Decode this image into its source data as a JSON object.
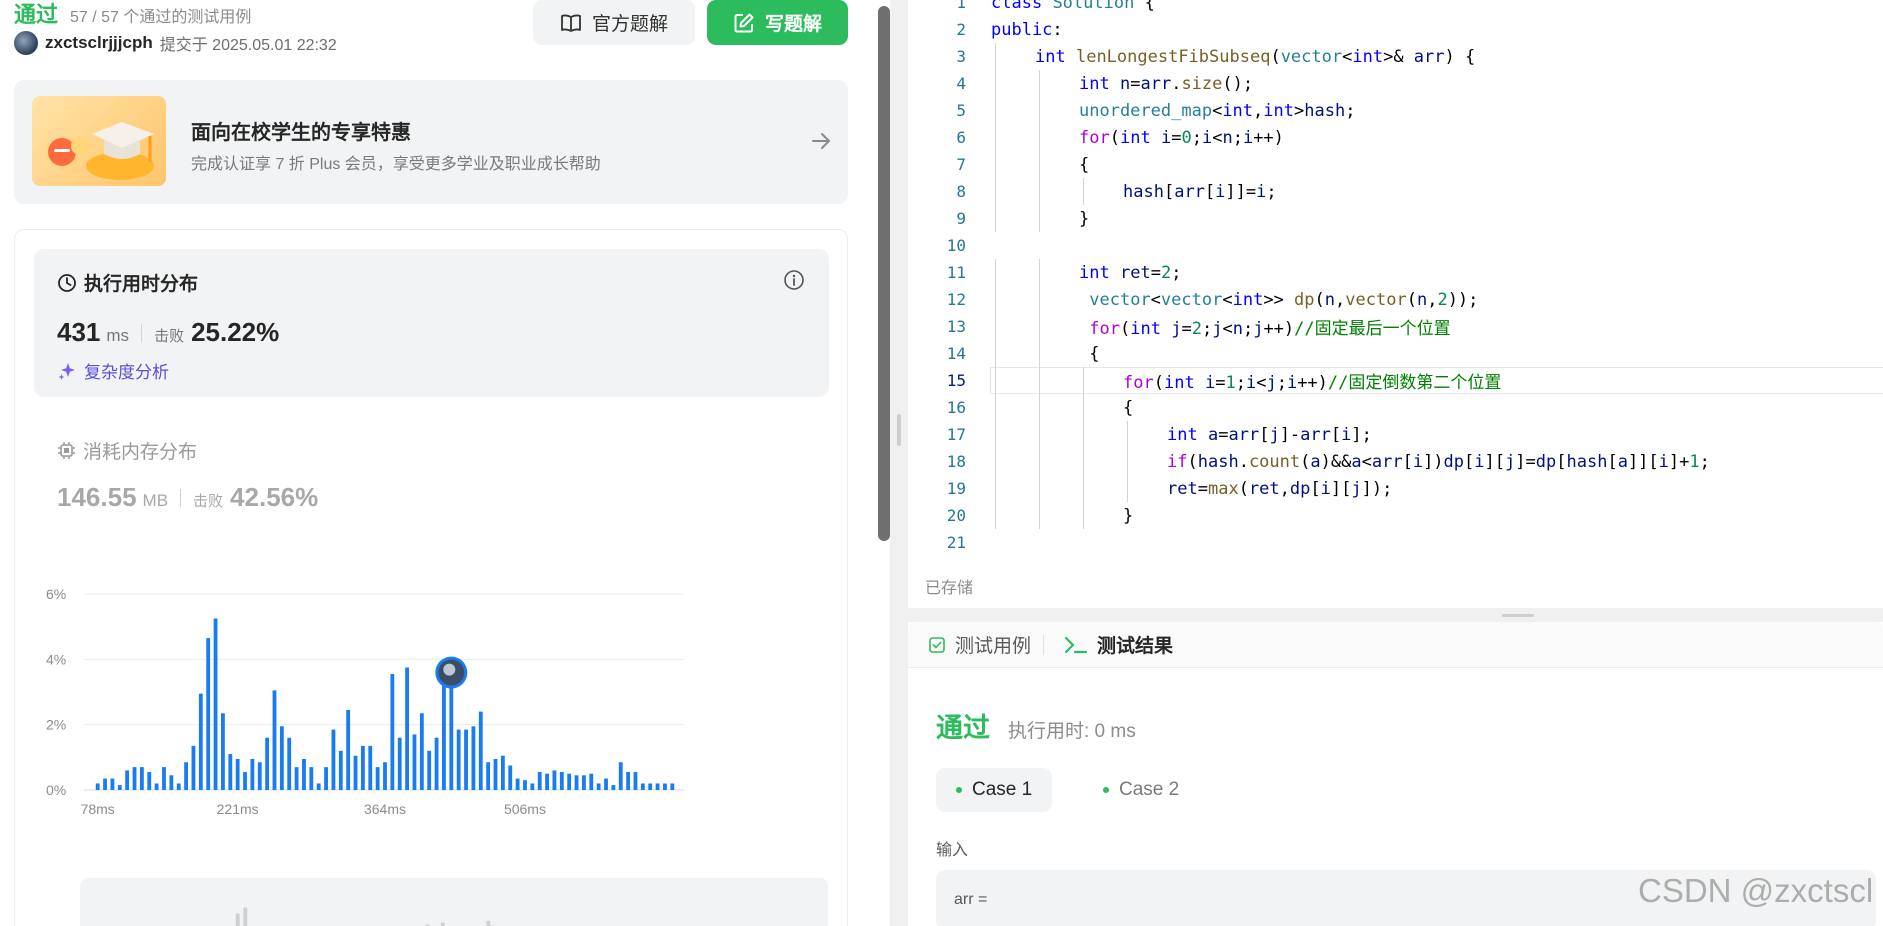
{
  "submission": {
    "status": "通过",
    "cases_passed": "57 / 57 个通过的测试用例",
    "author": "zxctsclrjjjcph",
    "submitted_at": "提交于 2025.05.01 22:32"
  },
  "buttons": {
    "official_solution": "官方题解",
    "write_solution": "写题解"
  },
  "promo": {
    "title": "面向在校学生的专享特惠",
    "subtitle": "完成认证享 7 折 Plus 会员，享受更多学业及职业成长帮助"
  },
  "runtime": {
    "title": "执行用时分布",
    "value": "431",
    "unit": "ms",
    "beat_label": "击败",
    "beat_pct": "25.22%",
    "complexity_link": "复杂度分析"
  },
  "memory": {
    "title": "消耗内存分布",
    "value": "146.55",
    "unit": "MB",
    "beat_label": "击败",
    "beat_pct": "42.56%"
  },
  "chart_data": {
    "type": "bar",
    "ylim": [
      0,
      6
    ],
    "yticks": [
      "0%",
      "2%",
      "4%",
      "6%"
    ],
    "xtick_labels": [
      "78ms",
      "221ms",
      "364ms",
      "506ms"
    ],
    "xtick_bar_index": [
      0,
      19,
      39,
      58
    ],
    "user_bar_index": 48,
    "color": "#1a7cf2",
    "values": [
      0.2,
      0.35,
      0.35,
      0.15,
      0.6,
      0.7,
      0.7,
      0.55,
      0.2,
      0.7,
      0.45,
      0.2,
      0.85,
      1.35,
      2.95,
      4.65,
      5.25,
      2.35,
      1.1,
      0.95,
      0.55,
      0.95,
      0.85,
      1.6,
      3.05,
      1.95,
      1.6,
      0.7,
      0.95,
      0.7,
      0.2,
      0.7,
      1.85,
      1.2,
      2.45,
      1.05,
      1.35,
      1.35,
      0.7,
      0.85,
      3.55,
      1.6,
      3.75,
      1.7,
      2.35,
      1.2,
      1.6,
      3.3,
      3.9,
      1.85,
      1.85,
      1.95,
      2.4,
      0.85,
      0.95,
      1.05,
      0.75,
      0.35,
      0.3,
      0.2,
      0.55,
      0.5,
      0.6,
      0.55,
      0.5,
      0.45,
      0.45,
      0.5,
      0.2,
      0.35,
      0.15,
      0.85,
      0.55,
      0.55,
      0.2,
      0.2,
      0.2,
      0.2,
      0.2
    ]
  },
  "mini_chart": {
    "labels": [
      "78",
      "221",
      "364",
      "506"
    ]
  },
  "editor": {
    "lines": [
      {
        "n": "1",
        "indent": 0,
        "html": "<span class=\"k\">class</span> <span class=\"t\">Solution</span> {"
      },
      {
        "n": "2",
        "indent": 0,
        "html": "<span class=\"k\">public</span>:"
      },
      {
        "n": "3",
        "indent": 1,
        "html": "<span class=\"k\">int</span> <span class=\"f\">lenLongestFibSubseq</span>(<span class=\"t\">vector</span>&lt;<span class=\"k\">int</span>&gt;&amp; <span class=\"v\">arr</span>) {"
      },
      {
        "n": "4",
        "indent": 2,
        "html": "<span class=\"k\">int</span> <span class=\"v\">n</span>=<span class=\"v\">arr</span>.<span class=\"f\">size</span>();"
      },
      {
        "n": "5",
        "indent": 2,
        "html": "<span class=\"t\">unordered_map</span>&lt;<span class=\"k\">int</span>,<span class=\"k\">int</span>&gt;<span class=\"v\">hash</span>;"
      },
      {
        "n": "6",
        "indent": 2,
        "html": "<span class=\"c\">for</span>(<span class=\"k\">int</span> <span class=\"v\">i</span>=<span class=\"n\">0</span>;<span class=\"v\">i</span>&lt;<span class=\"v\">n</span>;<span class=\"v\">i</span>++)"
      },
      {
        "n": "7",
        "indent": 2,
        "html": "{"
      },
      {
        "n": "8",
        "indent": 3,
        "html": "<span class=\"v\">hash</span>[<span class=\"v\">arr</span>[<span class=\"v\">i</span>]]=<span class=\"v\">i</span>;"
      },
      {
        "n": "9",
        "indent": 2,
        "html": "}"
      },
      {
        "n": "10",
        "indent": 0,
        "html": ""
      },
      {
        "n": "11",
        "indent": 2,
        "html": "<span class=\"k\">int</span> <span class=\"v\">ret</span>=<span class=\"n\">2</span>;"
      },
      {
        "n": "12",
        "indent": 2,
        "html": " <span class=\"t\">vector</span>&lt;<span class=\"t\">vector</span>&lt;<span class=\"k\">int</span>&gt;&gt; <span class=\"f\">dp</span>(<span class=\"v\">n</span>,<span class=\"f\">vector</span>(<span class=\"v\">n</span>,<span class=\"n\">2</span>));"
      },
      {
        "n": "13",
        "indent": 2,
        "html": " <span class=\"c\">for</span>(<span class=\"k\">int</span> <span class=\"v\">j</span>=<span class=\"n\">2</span>;<span class=\"v\">j</span>&lt;<span class=\"v\">n</span>;<span class=\"v\">j</span>++)<span class=\"cm\">//固定最后一个位置</span>"
      },
      {
        "n": "14",
        "indent": 2,
        "html": " {"
      },
      {
        "n": "15",
        "indent": 3,
        "html": "<span class=\"c\">for</span>(<span class=\"k\">int</span> <span class=\"v\">i</span>=<span class=\"n\">1</span>;<span class=\"v\">i</span>&lt;<span class=\"v\">j</span>;<span class=\"v\">i</span>++)<span class=\"cm\">//固定倒数第二个位置</span>",
        "current": true
      },
      {
        "n": "16",
        "indent": 3,
        "html": "{"
      },
      {
        "n": "17",
        "indent": 4,
        "html": "<span class=\"k\">int</span> <span class=\"v\">a</span>=<span class=\"v\">arr</span>[<span class=\"v\">j</span>]-<span class=\"v\">arr</span>[<span class=\"v\">i</span>];"
      },
      {
        "n": "18",
        "indent": 4,
        "html": "<span class=\"c\">if</span>(<span class=\"v\">hash</span>.<span class=\"f\">count</span>(<span class=\"v\">a</span>)&amp;&amp;<span class=\"v\">a</span>&lt;<span class=\"v\">arr</span>[<span class=\"v\">i</span>])<span class=\"v\">dp</span>[<span class=\"v\">i</span>][<span class=\"v\">j</span>]=<span class=\"v\">dp</span>[<span class=\"v\">hash</span>[<span class=\"v\">a</span>]][<span class=\"v\">i</span>]+<span class=\"n\">1</span>;"
      },
      {
        "n": "19",
        "indent": 4,
        "html": "<span class=\"v\">ret</span>=<span class=\"f\">max</span>(<span class=\"v\">ret</span>,<span class=\"v\">dp</span>[<span class=\"v\">i</span>][<span class=\"v\">j</span>]);"
      },
      {
        "n": "20",
        "indent": 3,
        "html": "}"
      },
      {
        "n": "21",
        "indent": 0,
        "html": ""
      }
    ],
    "saved_status": "已存储"
  },
  "console": {
    "tab_testcase": "测试用例",
    "tab_result": "测试结果",
    "result_status": "通过",
    "runtime_text": "执行用时: 0 ms",
    "cases": [
      "Case 1",
      "Case 2"
    ],
    "input_label": "输入",
    "input_prefix": "arr ="
  },
  "watermark": "CSDN @zxctscl"
}
